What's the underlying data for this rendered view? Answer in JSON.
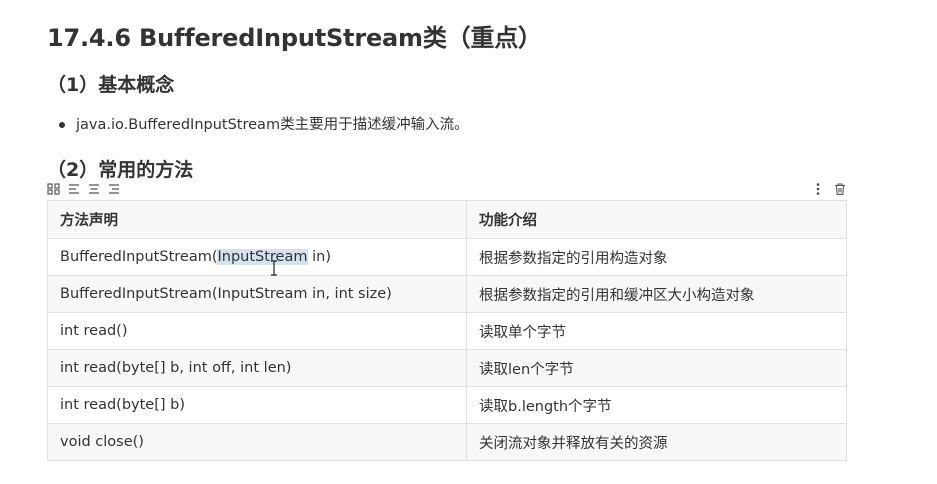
{
  "heading": "17.4.6 BufferedInputStream类（重点）",
  "section1": {
    "title": "（1）基本概念",
    "bullets": [
      "java.io.BufferedInputStream类主要用于描述缓冲输入流。"
    ]
  },
  "section2": {
    "title": "（2）常用的方法"
  },
  "table_toolbar": {
    "left_icons": [
      "grid-icon",
      "align-left-icon",
      "align-center-icon",
      "align-right-icon"
    ],
    "right_icons": [
      "more-vertical-icon",
      "trash-icon"
    ]
  },
  "table": {
    "headers": [
      "方法声明",
      "功能介绍"
    ],
    "rows": [
      {
        "method_before": "BufferedInputStream(",
        "method_selected": "InputStream",
        "method_after": " in)",
        "desc": "根据参数指定的引用构造对象"
      },
      {
        "method": "BufferedInputStream(InputStream in, int size)",
        "desc": "根据参数指定的引用和缓冲区大小构造对象"
      },
      {
        "method": "int read()",
        "desc": "读取单个字节"
      },
      {
        "method": "int read(byte[] b, int off, int len)",
        "desc": "读取len个字节"
      },
      {
        "method": "int read(byte[] b)",
        "desc": "读取b.length个字节"
      },
      {
        "method": "void  close()",
        "desc": "关闭流对象并释放有关的资源"
      }
    ]
  },
  "colors": {
    "text": "#333333",
    "border": "#dfe2e5",
    "header_bg": "#f8f8f8",
    "selection": "#d4e1ee"
  }
}
